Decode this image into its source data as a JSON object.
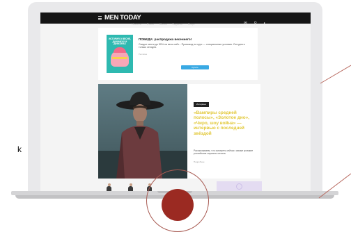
{
  "site": {
    "logo": "MEN TODAY",
    "nav": [
      "Новости",
      "Стиль",
      "Жизнь",
      "Гаджеты",
      "Спорт"
    ],
    "top_icons": [
      "mail-icon",
      "search-icon",
      "user-icon"
    ]
  },
  "ad": {
    "book_title": "ИСТОРИЯ О ВЕСНЕ, ДАЧНИКАХ И ДРАКОНАХ",
    "title": "ПОБЕДА: распродажа весеннего!",
    "text": "Скидки: книги до 50% на весь сайт... Промокод на курс — специальные условия. Сегодня и только сегодня.",
    "note": "Реклама",
    "button": "Купить"
  },
  "feature": {
    "tag": "Интервью",
    "headline": "«Вампиры средней полосы», «Золотое дно», «Чиро, шоу война» — интервью с последней звёздой",
    "summary": "Рассказываем, что смотреть сейчас: самые громкие российские сериалы сезона.",
    "more": "Подробнее"
  },
  "side_letter": "k",
  "colors": {
    "headline": "#e2c838",
    "topbar": "#151515",
    "accent_button": "#39a9e3",
    "overlay_dot": "#9b2a22"
  }
}
